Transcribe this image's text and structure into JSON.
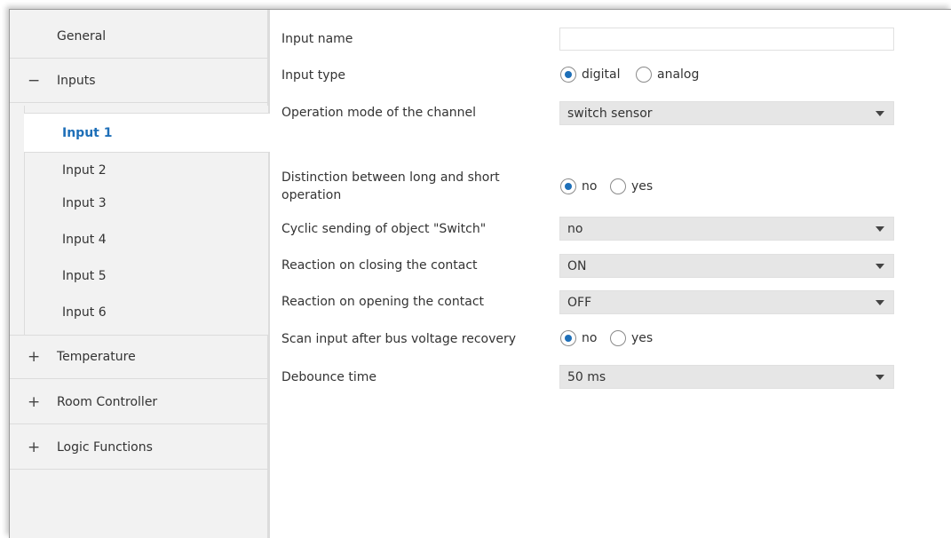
{
  "sidebar": {
    "general": "General",
    "inputs": {
      "prefix": "−",
      "label": "Inputs"
    },
    "input_items": [
      "Input 1",
      "Input 2",
      "Input 3",
      "Input 4",
      "Input 5",
      "Input 6"
    ],
    "active_item": "Input 1",
    "temperature": {
      "prefix": "+",
      "label": "Temperature"
    },
    "room_controller": {
      "prefix": "+",
      "label": "Room Controller"
    },
    "logic_functions": {
      "prefix": "+",
      "label": "Logic Functions"
    }
  },
  "form": {
    "input_name": {
      "label": "Input name",
      "value": ""
    },
    "input_type": {
      "label": "Input type",
      "options": [
        "digital",
        "analog"
      ],
      "selected": "digital"
    },
    "operation_mode": {
      "label": "Operation mode of the channel",
      "value": "switch sensor"
    },
    "distinction": {
      "label_line1": "Distinction between long and short",
      "label_line2": "operation",
      "options": [
        "no",
        "yes"
      ],
      "selected": "no"
    },
    "cyclic_sending": {
      "label": "Cyclic sending of object \"Switch\"",
      "value": "no"
    },
    "reaction_closing": {
      "label": "Reaction on closing the contact",
      "value": "ON"
    },
    "reaction_opening": {
      "label": "Reaction on opening the contact",
      "value": "OFF"
    },
    "scan_input": {
      "label": "Scan input after bus voltage recovery",
      "options": [
        "no",
        "yes"
      ],
      "selected": "no"
    },
    "debounce_time": {
      "label": "Debounce time",
      "value": "50 ms"
    }
  },
  "colors": {
    "accent": "#1e6fb8",
    "sidebar_bg": "#f2f2f2",
    "dropdown_bg": "#e6e6e6"
  },
  "icons": {
    "expanded": "minus-icon",
    "collapsed": "plus-icon",
    "dropdown": "chevron-down-icon"
  }
}
